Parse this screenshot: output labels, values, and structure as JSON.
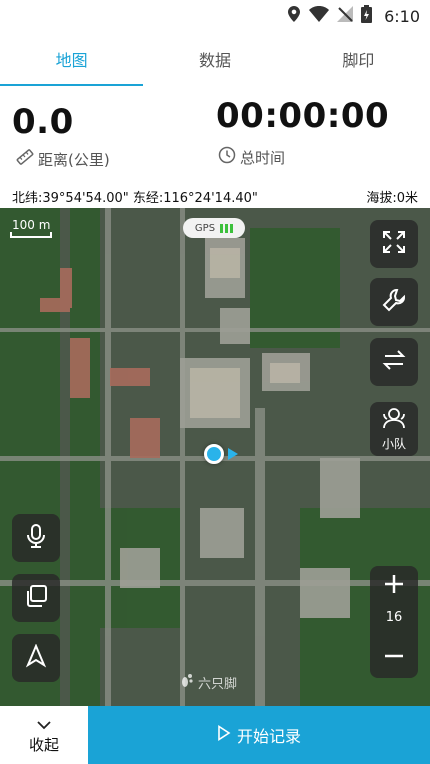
{
  "status_bar": {
    "time": "6:10",
    "icons": [
      "location-icon",
      "wifi-icon",
      "signal-off-icon",
      "battery-charging-icon"
    ]
  },
  "tabs": [
    {
      "label": "地图",
      "active": true
    },
    {
      "label": "数据",
      "active": false
    },
    {
      "label": "脚印",
      "active": false
    }
  ],
  "stats": {
    "distance_value": "0.0",
    "distance_label": "距离(公里)",
    "duration_value": "00:00:00",
    "duration_label": "总时间"
  },
  "location": {
    "coords": "北纬:39°54'54.00\" 东经:116°24'14.40\"",
    "altitude": "海拔:0米"
  },
  "map": {
    "scale_label": "100 m",
    "gps_label": "GPS",
    "team_label": "小队",
    "zoom_level": "16",
    "watermark": "六只脚",
    "accent_color": "#1aa3d6"
  },
  "bottom": {
    "collapse_label": "收起",
    "start_label": "开始记录"
  }
}
